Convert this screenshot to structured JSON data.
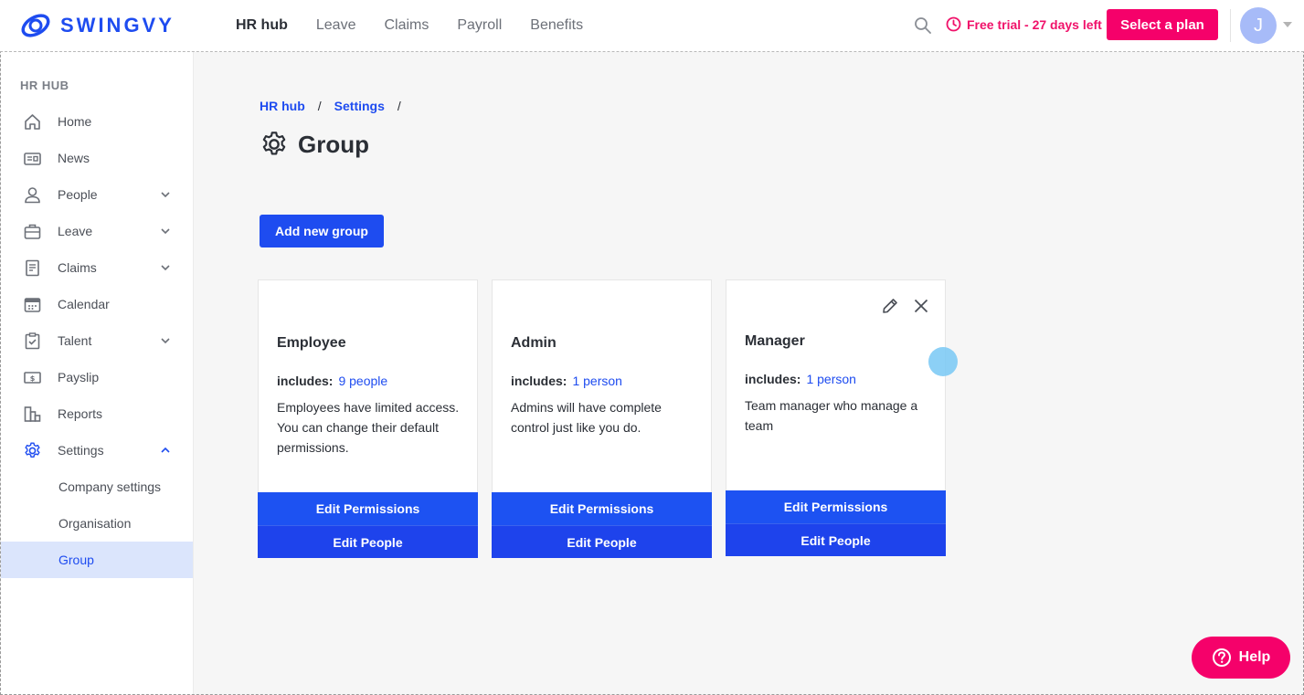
{
  "brand": {
    "name": "SWINGVY",
    "color": "#1e4cf0",
    "accent": "#f5016a"
  },
  "topnav": {
    "items": [
      {
        "label": "HR hub",
        "active": true
      },
      {
        "label": "Leave"
      },
      {
        "label": "Claims"
      },
      {
        "label": "Payroll"
      },
      {
        "label": "Benefits"
      }
    ],
    "trial_text": "Free trial - 27 days left",
    "plan_button": "Select a plan",
    "avatar_initial": "J"
  },
  "sidebar": {
    "heading": "HR HUB",
    "items": [
      {
        "label": "Home",
        "icon": "home-icon"
      },
      {
        "label": "News",
        "icon": "news-icon"
      },
      {
        "label": "People",
        "icon": "person-icon",
        "expandable": true
      },
      {
        "label": "Leave",
        "icon": "briefcase-icon",
        "expandable": true
      },
      {
        "label": "Claims",
        "icon": "receipt-icon",
        "expandable": true
      },
      {
        "label": "Calendar",
        "icon": "calendar-icon"
      },
      {
        "label": "Talent",
        "icon": "clipboard-icon",
        "expandable": true
      },
      {
        "label": "Payslip",
        "icon": "money-icon"
      },
      {
        "label": "Reports",
        "icon": "reports-icon"
      },
      {
        "label": "Settings",
        "icon": "gear-icon",
        "expanded": true
      }
    ],
    "sub_items": [
      {
        "label": "Company settings"
      },
      {
        "label": "Organisation"
      },
      {
        "label": "Group",
        "selected": true
      }
    ]
  },
  "breadcrumb": {
    "items": [
      "HR hub",
      "Settings"
    ],
    "separator": "/"
  },
  "page": {
    "title": "Group",
    "add_button": "Add new group"
  },
  "groups": [
    {
      "name": "Employee",
      "includes_label": "includes:",
      "count": "9 people",
      "description": "Employees have limited access. You can change their default permissions.",
      "edit_permissions": "Edit Permissions",
      "edit_people": "Edit People"
    },
    {
      "name": "Admin",
      "includes_label": "includes:",
      "count": "1 person",
      "description": "Admins will have complete control just like you do.",
      "edit_permissions": "Edit Permissions",
      "edit_people": "Edit People"
    },
    {
      "name": "Manager",
      "includes_label": "includes:",
      "count": "1 person",
      "description": "Team manager who manage a team",
      "edit_permissions": "Edit Permissions",
      "edit_people": "Edit People"
    }
  ],
  "help_button": "Help"
}
